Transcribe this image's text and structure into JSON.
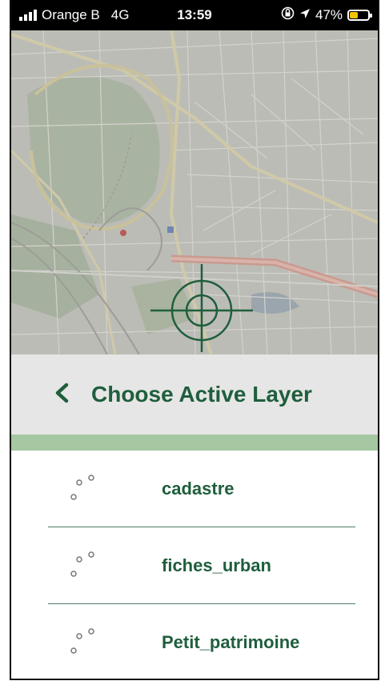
{
  "status_bar": {
    "carrier": "Orange B",
    "network": "4G",
    "time": "13:59",
    "battery_percent": "47%",
    "battery_level": 0.47,
    "icons": [
      "signal-bars-icon",
      "orientation-lock-icon",
      "location-arrow-icon",
      "battery-icon"
    ]
  },
  "map": {
    "crosshair_icon": "crosshair-target-icon",
    "crosshair_color": "#1f5e3c"
  },
  "header": {
    "back_icon": "chevron-left-icon",
    "title": "Choose Active Layer"
  },
  "layers": [
    {
      "name": "cadastre",
      "icon": "vector-points-icon"
    },
    {
      "name": "fiches_urban",
      "icon": "vector-points-icon"
    },
    {
      "name": "Petit_patrimoine",
      "icon": "vector-points-icon"
    }
  ],
  "colors": {
    "accent": "#1f5e3c",
    "stripe": "#a5c7a1",
    "header_bg": "#e6e6e6"
  }
}
